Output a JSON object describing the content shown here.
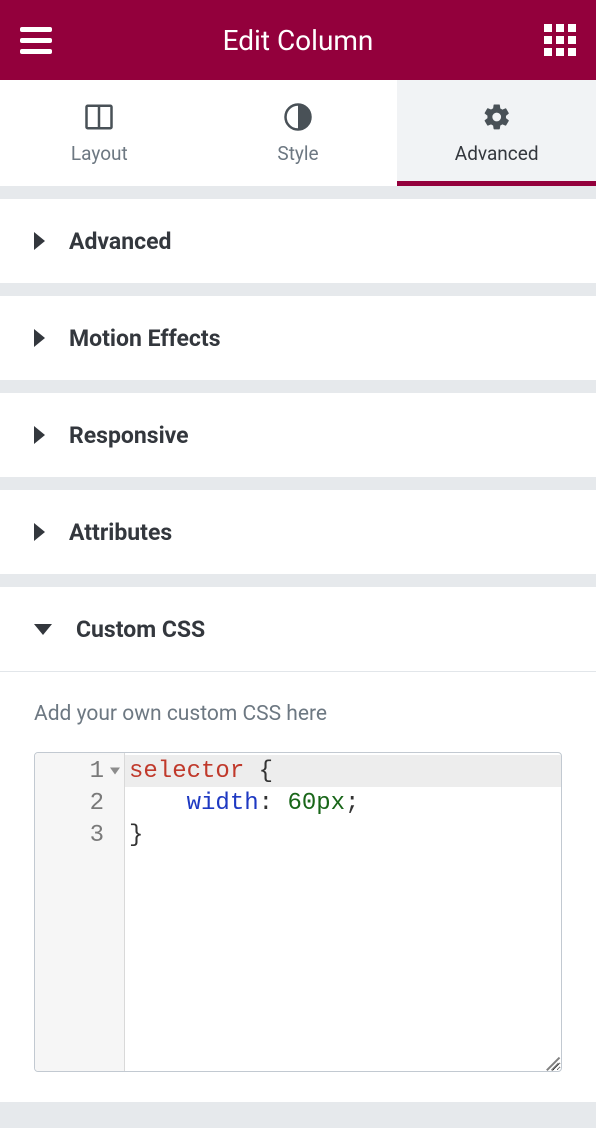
{
  "header": {
    "title": "Edit Column"
  },
  "tabs": {
    "layout": "Layout",
    "style": "Style",
    "advanced": "Advanced"
  },
  "sections": {
    "advanced": "Advanced",
    "motion": "Motion Effects",
    "responsive": "Responsive",
    "attributes": "Attributes",
    "customcss": "Custom CSS"
  },
  "customcss": {
    "hint": "Add your own custom CSS here",
    "gutter": {
      "l1": "1",
      "l2": "2",
      "l3": "3"
    },
    "code": {
      "l1_selector": "selector",
      "l1_brace": " {",
      "l2_indent": "    ",
      "l2_prop": "width",
      "l2_colon": ": ",
      "l2_val": "60px",
      "l2_semi": ";",
      "l3": "}"
    }
  }
}
